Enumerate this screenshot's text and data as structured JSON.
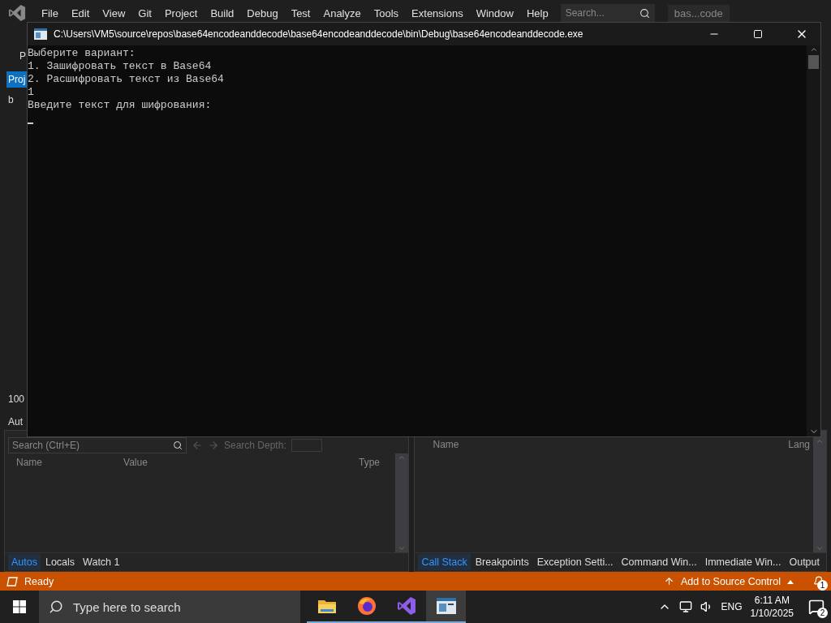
{
  "ide": {
    "menu": [
      "File",
      "Edit",
      "View",
      "Git",
      "Project",
      "Build",
      "Debug",
      "Test",
      "Analyze",
      "Tools",
      "Extensions",
      "Window",
      "Help"
    ],
    "search": {
      "placeholder": "Search..."
    },
    "solution_name": "bas...code",
    "side_texts": {
      "top": "P",
      "tab": "Proj",
      "file": "b",
      "zoom": "100",
      "panel": "Aut"
    }
  },
  "console": {
    "title": "C:\\Users\\VM5\\source\\repos\\base64encodeanddecode\\base64encodeanddecode\\bin\\Debug\\base64encodeanddecode.exe",
    "lines": [
      "Выберите вариант:",
      "1. Зашифровать текст в Base64",
      "2. Расшифровать текст из Base64",
      "1",
      "Введите текст для шифрования:"
    ]
  },
  "autos_panel": {
    "search": {
      "placeholder": "Search (Ctrl+E)"
    },
    "depth_label": "Search Depth:",
    "columns": [
      "Name",
      "Value",
      "Type"
    ],
    "tabs": [
      {
        "label": "Autos",
        "selected": true
      },
      {
        "label": "Locals",
        "selected": false
      },
      {
        "label": "Watch 1",
        "selected": false
      }
    ]
  },
  "call_stack_panel": {
    "columns": [
      "Name",
      "Lang"
    ],
    "tabs": [
      {
        "label": "Call Stack",
        "selected": true
      },
      {
        "label": "Breakpoints",
        "selected": false
      },
      {
        "label": "Exception Setti...",
        "selected": false
      },
      {
        "label": "Command Win...",
        "selected": false
      },
      {
        "label": "Immediate Win...",
        "selected": false
      },
      {
        "label": "Output",
        "selected": false
      }
    ]
  },
  "status_bar": {
    "status": "Ready",
    "source_control": "Add to Source Control",
    "notifications": "1"
  },
  "taskbar": {
    "search": {
      "placeholder": "Type here to search"
    },
    "apps": [
      {
        "kind": "folder",
        "selected": false
      },
      {
        "kind": "browser",
        "selected": false
      },
      {
        "kind": "ide",
        "selected": false
      },
      {
        "kind": "console",
        "selected": true
      }
    ],
    "language": "ENG",
    "time": "6:11 AM",
    "date": "1/10/2025",
    "notifications": "2"
  }
}
